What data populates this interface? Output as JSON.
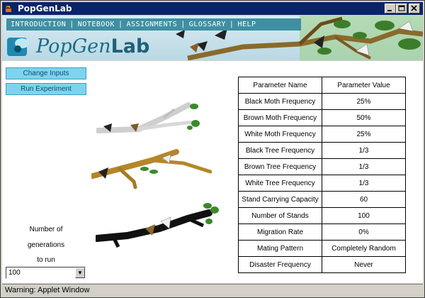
{
  "window": {
    "title": "PopGenLab",
    "controls": [
      "_",
      "□",
      "×"
    ]
  },
  "nav": [
    "INTRODUCTION",
    "NOTEBOOK",
    "ASSIGNMENTS",
    "GLOSSARY",
    "HELP"
  ],
  "logo": {
    "part1": "PopGen",
    "part2": "Lab"
  },
  "buttons": {
    "change_inputs": "Change Inputs",
    "run_experiment": "Run Experiment"
  },
  "generations": {
    "line1": "Number of",
    "line2": "generations",
    "line3": "to run",
    "value": "100"
  },
  "table": {
    "headers": [
      "Parameter Name",
      "Parameter Value"
    ],
    "rows": [
      [
        "Black Moth Frequency",
        "25%"
      ],
      [
        "Brown Moth Frequency",
        "50%"
      ],
      [
        "White Moth Frequency",
        "25%"
      ],
      [
        "Black Tree Frequency",
        "1/3"
      ],
      [
        "Brown Tree Frequency",
        "1/3"
      ],
      [
        "White Tree Frequency",
        "1/3"
      ],
      [
        "Stand Carrying Capacity",
        "60"
      ],
      [
        "Number of Stands",
        "100"
      ],
      [
        "Migration Rate",
        "0%"
      ],
      [
        "Mating Pattern",
        "Completely Random"
      ],
      [
        "Disaster Frequency",
        "Never"
      ]
    ]
  },
  "status": "Warning: Applet Window",
  "colors": {
    "titlebar": "#0a246a",
    "nav": "#3f8fa3",
    "button": "#7ed3f0",
    "white_tree": "#cfcfcf",
    "brown_tree": "#b5862a",
    "black_tree": "#111111"
  }
}
